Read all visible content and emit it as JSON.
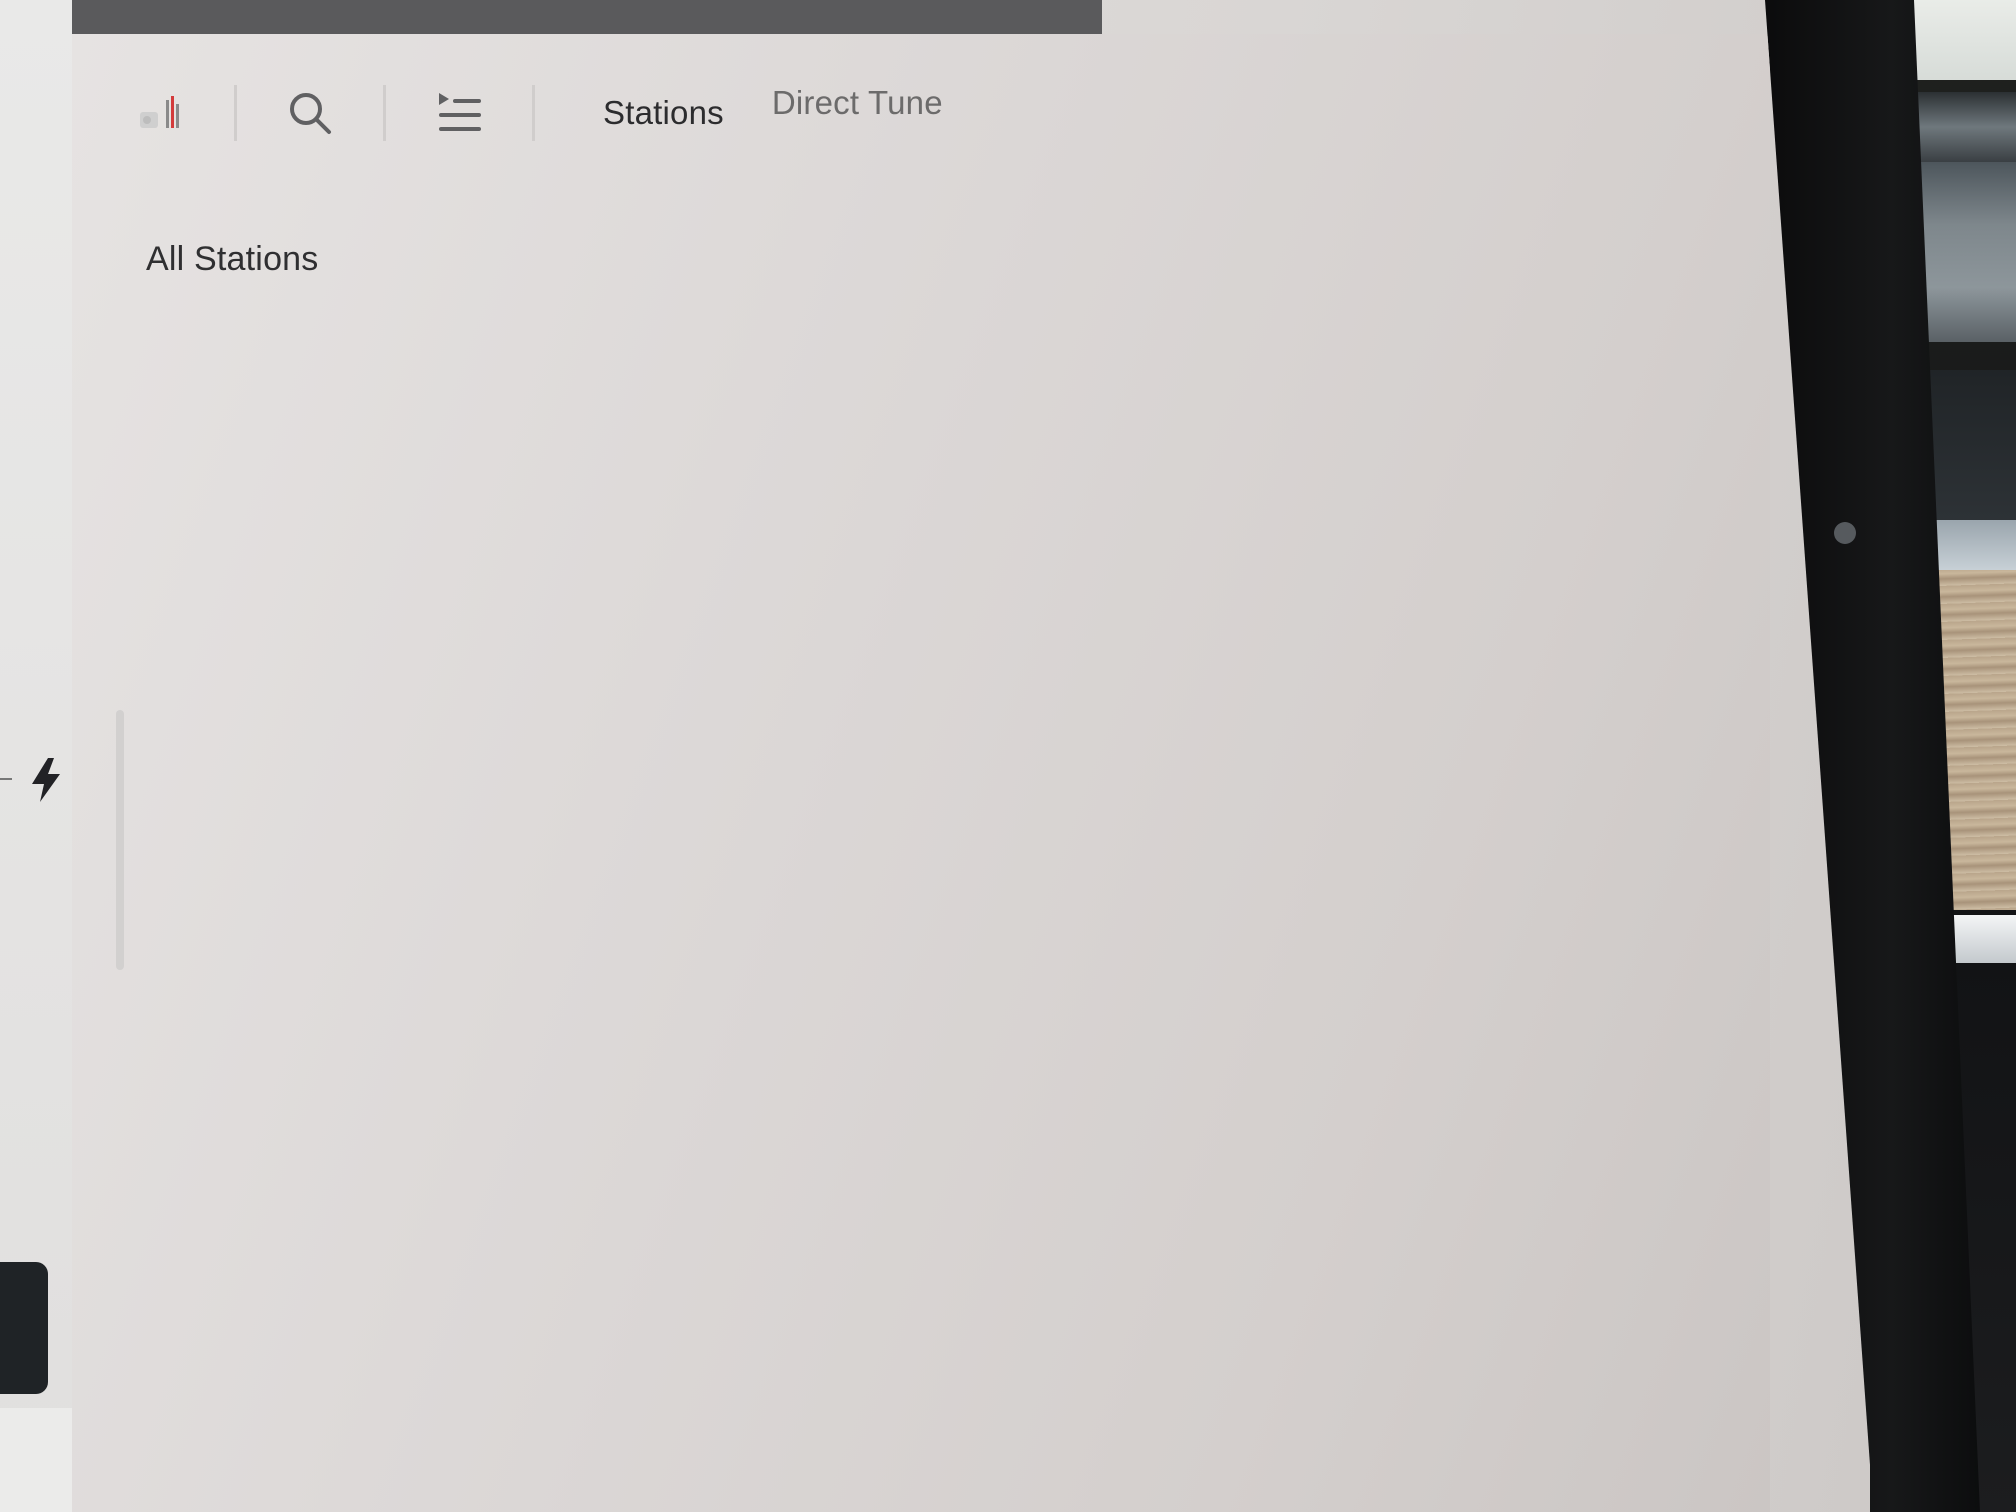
{
  "toolbar": {
    "icons": [
      "radio-source-icon",
      "search-icon",
      "queue-list-icon"
    ],
    "tabs": [
      {
        "label": "Stations",
        "active": true
      },
      {
        "label": "Direct Tune",
        "active": false
      }
    ]
  },
  "main": {
    "section_title": "All Stations"
  },
  "sidebar": {
    "icons": [
      "lightning-bolt-icon"
    ]
  },
  "colors": {
    "panel_background": "#dedad9",
    "text_primary": "#2c2c2e",
    "text_secondary": "#6c6b6b",
    "accent_red": "#d33b3b"
  }
}
